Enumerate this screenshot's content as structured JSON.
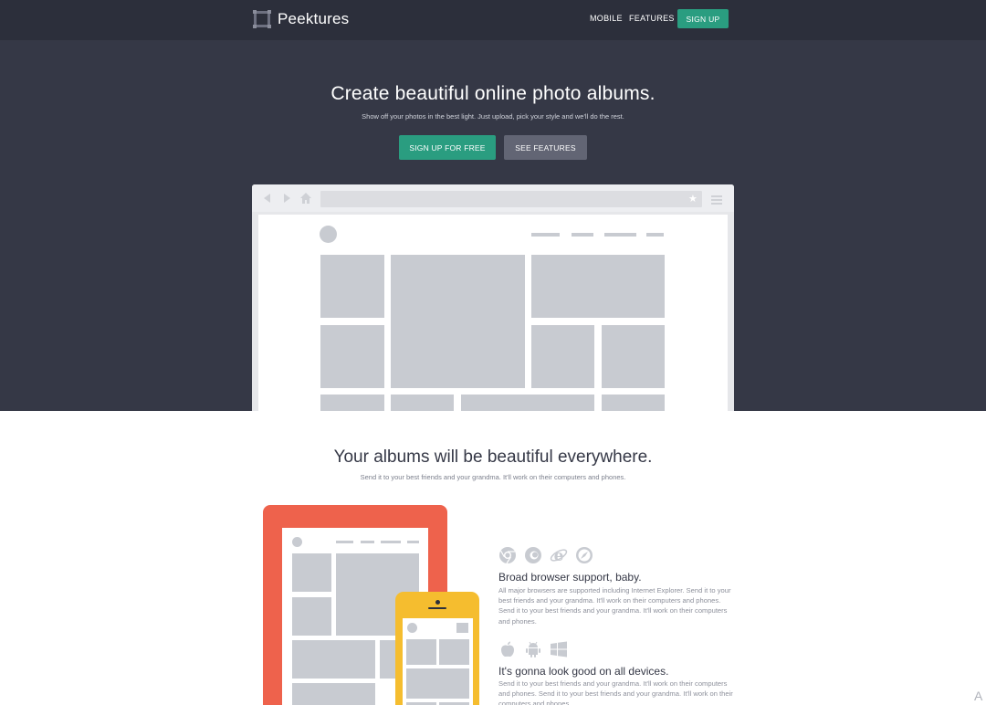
{
  "brand": {
    "name": "Peektures"
  },
  "nav": {
    "mobile": "MOBILE",
    "features": "FEATURES",
    "signup": "SIGN UP"
  },
  "hero": {
    "title": "Create beautiful online photo albums.",
    "subtitle": "Show off your photos in the best light.  Just upload, pick your style and we'll do the rest.",
    "cta_primary": "SIGN UP FOR FREE",
    "cta_secondary": "SEE FEATURES"
  },
  "section2": {
    "title": "Your albums will be beautiful everywhere.",
    "subtitle": "Send it to your best friends and your grandma. It'll work on their computers and phones."
  },
  "features": [
    {
      "title": "Broad browser support, baby.",
      "text": "All major browsers are supported including Internet Explorer. Send it to your best friends and your grandma. It'll work on their computers and phones. Send it to your best friends and your grandma. It'll work on their computers and phones.",
      "icons": [
        "chrome-icon",
        "firefox-icon",
        "internet-explorer-icon",
        "safari-icon"
      ]
    },
    {
      "title": "It's gonna look good on all devices.",
      "text": "Send it to your best friends and your grandma. It'll work on their computers and phones. Send it to your best friends and your grandma. It'll work on their computers and phones.",
      "icons": [
        "apple-icon",
        "android-icon",
        "windows-icon"
      ]
    }
  ],
  "colors": {
    "nav_bg": "#2c2f3b",
    "hero_bg": "#353846",
    "accent": "#2a9d80",
    "secondary_button": "#626574",
    "tablet": "#ee624c",
    "phone": "#f5bd2f",
    "placeholder": "#c8cbd1"
  },
  "corner_glyph": "A"
}
